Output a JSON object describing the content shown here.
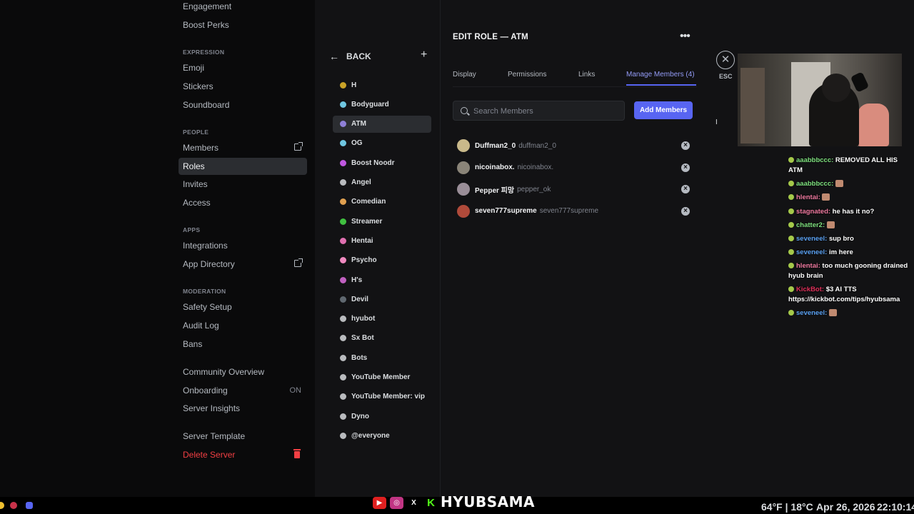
{
  "sidebar": {
    "items_top": [
      {
        "label": "Engagement"
      },
      {
        "label": "Boost Perks"
      }
    ],
    "sections": {
      "expression": "EXPRESSION",
      "people": "PEOPLE",
      "apps": "APPS",
      "moderation": "MODERATION"
    },
    "expression_items": [
      "Emoji",
      "Stickers",
      "Soundboard"
    ],
    "people_items": [
      "Members",
      "Roles",
      "Invites",
      "Access"
    ],
    "apps_items": [
      "Integrations",
      "App Directory"
    ],
    "moderation_items": [
      "Safety Setup",
      "Audit Log",
      "Bans"
    ],
    "community_items": [
      "Community Overview",
      "Onboarding",
      "Server Insights"
    ],
    "onboarding_badge": "ON",
    "server_template": "Server Template",
    "delete_server": "Delete Server",
    "active_item": "Roles"
  },
  "roles_panel": {
    "back_label": "BACK",
    "roles": [
      {
        "name": "H",
        "color": "#c9a227"
      },
      {
        "name": "Bodyguard",
        "color": "#6fc6e0"
      },
      {
        "name": "ATM",
        "color": "#8f80d8"
      },
      {
        "name": "OG",
        "color": "#6fc6e0"
      },
      {
        "name": "Boost Noodr",
        "color": "#c058e0"
      },
      {
        "name": "Angel",
        "color": "#b9bbbe"
      },
      {
        "name": "Comedian",
        "color": "#e0a050"
      },
      {
        "name": "Streamer",
        "color": "#40c040"
      },
      {
        "name": "Hentai",
        "color": "#e070b0"
      },
      {
        "name": "Psycho",
        "color": "#f08ac0"
      },
      {
        "name": "H's",
        "color": "#c060c0"
      },
      {
        "name": "Devil",
        "color": "#606870"
      },
      {
        "name": "hyubot",
        "color": "#b9bbbe"
      },
      {
        "name": "Sx Bot",
        "color": "#b9bbbe"
      },
      {
        "name": "Bots",
        "color": "#b9bbbe"
      },
      {
        "name": "YouTube Member",
        "color": "#b9bbbe"
      },
      {
        "name": "YouTube Member: vip",
        "color": "#b9bbbe"
      },
      {
        "name": "Dyno",
        "color": "#b9bbbe"
      },
      {
        "name": "@everyone",
        "color": "#b9bbbe"
      }
    ],
    "active_role": "ATM"
  },
  "edit_role": {
    "title": "EDIT ROLE — ATM",
    "tabs": [
      {
        "label": "Display"
      },
      {
        "label": "Permissions"
      },
      {
        "label": "Links"
      },
      {
        "label": "Manage Members (4)"
      }
    ],
    "active_tab": "Manage Members (4)",
    "search_placeholder": "Search Members",
    "add_members_label": "Add Members",
    "members": [
      {
        "name": "Duffman2_0",
        "handle": "duffman2_0",
        "avatar_color": "#c9b98a"
      },
      {
        "name": "nicoinabox.",
        "handle": "nicoinabox.",
        "avatar_color": "#8a8478"
      },
      {
        "name": "Pepper 피망",
        "handle": "pepper_ok",
        "avatar_color": "#9a8e98"
      },
      {
        "name": "seven777supreme",
        "handle": "seven777supreme",
        "avatar_color": "#b04a3a"
      }
    ]
  },
  "esc": {
    "label": "ESC"
  },
  "chat": {
    "messages": [
      {
        "user": "aaabbbccc:",
        "user_color": "#7ee07e",
        "text": " REMOVED ALL HIS ATM"
      },
      {
        "user": "aaabbbccc:",
        "user_color": "#7ee07e",
        "text": ""
      },
      {
        "user": "hlentai:",
        "user_color": "#f07aa0",
        "text": ""
      },
      {
        "user": "stagnated:",
        "user_color": "#f07aa0",
        "text": " he has it no?"
      },
      {
        "user": "chatter2:",
        "user_color": "#7ee07e",
        "text": ""
      },
      {
        "user": "seveneel:",
        "user_color": "#5aa0f0",
        "text": " sup bro"
      },
      {
        "user": "seveneel:",
        "user_color": "#5aa0f0",
        "text": " im here"
      },
      {
        "user": "hlentai:",
        "user_color": "#f07aa0",
        "text": " too much gooning drained hyub brain"
      },
      {
        "user": "KickBot:",
        "user_color": "#e0305a",
        "text": " $3 AI TTS https://kickbot.com/tips/hyubsama"
      },
      {
        "user": "seveneel:",
        "user_color": "#5aa0f0",
        "text": ""
      }
    ]
  },
  "bottombar": {
    "brand": "HYUBSAMA",
    "x_icon": "X",
    "kick_icon": "K",
    "weather": "64°F | 18°C",
    "date": "Apr 26, 2026",
    "time": "22:10:14"
  }
}
